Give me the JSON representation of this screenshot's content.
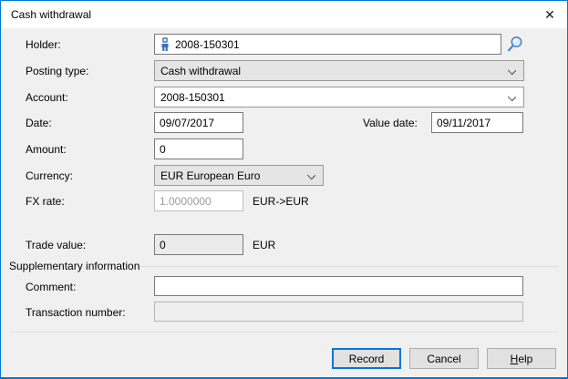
{
  "window": {
    "title": "Cash withdrawal",
    "close_glyph": "✕"
  },
  "colors": {
    "window_border": "#0077d7",
    "titlebar_bg": "#ffffff",
    "body_bg": "#f0f0f0",
    "default_button_border": "#0078d7",
    "button_bg": "#e1e1e1",
    "icon_blue": "#3a6fb5"
  },
  "form": {
    "holder": {
      "label": "Holder:",
      "value": "2008-150301"
    },
    "posting_type": {
      "label": "Posting type:",
      "value": "Cash withdrawal"
    },
    "account": {
      "label": "Account:",
      "value": "2008-150301"
    },
    "date": {
      "label": "Date:",
      "value": "09/07/2017"
    },
    "value_date": {
      "label": "Value date:",
      "value": "09/11/2017"
    },
    "amount": {
      "label": "Amount:",
      "value": "0"
    },
    "currency": {
      "label": "Currency:",
      "value": "EUR European Euro"
    },
    "fx_rate": {
      "label": "FX rate:",
      "value": "1.0000000",
      "suffix": "EUR->EUR"
    },
    "trade_value": {
      "label": "Trade value:",
      "value": "0",
      "suffix": "EUR"
    },
    "supplementary": {
      "section_label": "Supplementary information"
    },
    "comment": {
      "label": "Comment:",
      "value": ""
    },
    "transaction_number": {
      "label": "Transaction number:",
      "value": ""
    }
  },
  "buttons": {
    "record": "Record",
    "cancel": "Cancel",
    "help": "Help"
  }
}
